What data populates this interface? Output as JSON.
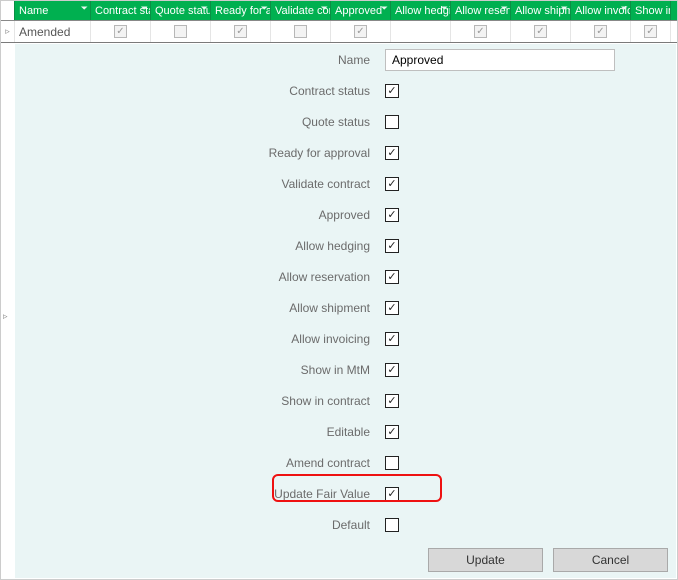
{
  "grid": {
    "columns": [
      "Name",
      "Contract status",
      "Quote status",
      "Ready for approval",
      "Validate contract",
      "Approved",
      "Allow hedging",
      "Allow reservation",
      "Allow shipment",
      "Allow invoicing",
      "Show in MtM"
    ],
    "row": {
      "name": "Amended",
      "values": [
        true,
        false,
        true,
        false,
        true,
        null,
        true,
        true,
        true,
        true
      ]
    }
  },
  "form": {
    "name_label": "Name",
    "name_value": "Approved",
    "fields": [
      {
        "label": "Contract status",
        "checked": true
      },
      {
        "label": "Quote status",
        "checked": false
      },
      {
        "label": "Ready for approval",
        "checked": true
      },
      {
        "label": "Validate contract",
        "checked": true
      },
      {
        "label": "Approved",
        "checked": true
      },
      {
        "label": "Allow hedging",
        "checked": true
      },
      {
        "label": "Allow reservation",
        "checked": true
      },
      {
        "label": "Allow shipment",
        "checked": true
      },
      {
        "label": "Allow invoicing",
        "checked": true
      },
      {
        "label": "Show in MtM",
        "checked": true
      },
      {
        "label": "Show in contract",
        "checked": true
      },
      {
        "label": "Editable",
        "checked": true
      },
      {
        "label": "Amend contract",
        "checked": false
      },
      {
        "label": "Update Fair Value",
        "checked": true,
        "highlight": true
      },
      {
        "label": "Default",
        "checked": false
      }
    ]
  },
  "buttons": {
    "update": "Update",
    "cancel": "Cancel"
  },
  "glyphs": {
    "check": "✓",
    "tri": "▹",
    "filter": "⏷"
  }
}
